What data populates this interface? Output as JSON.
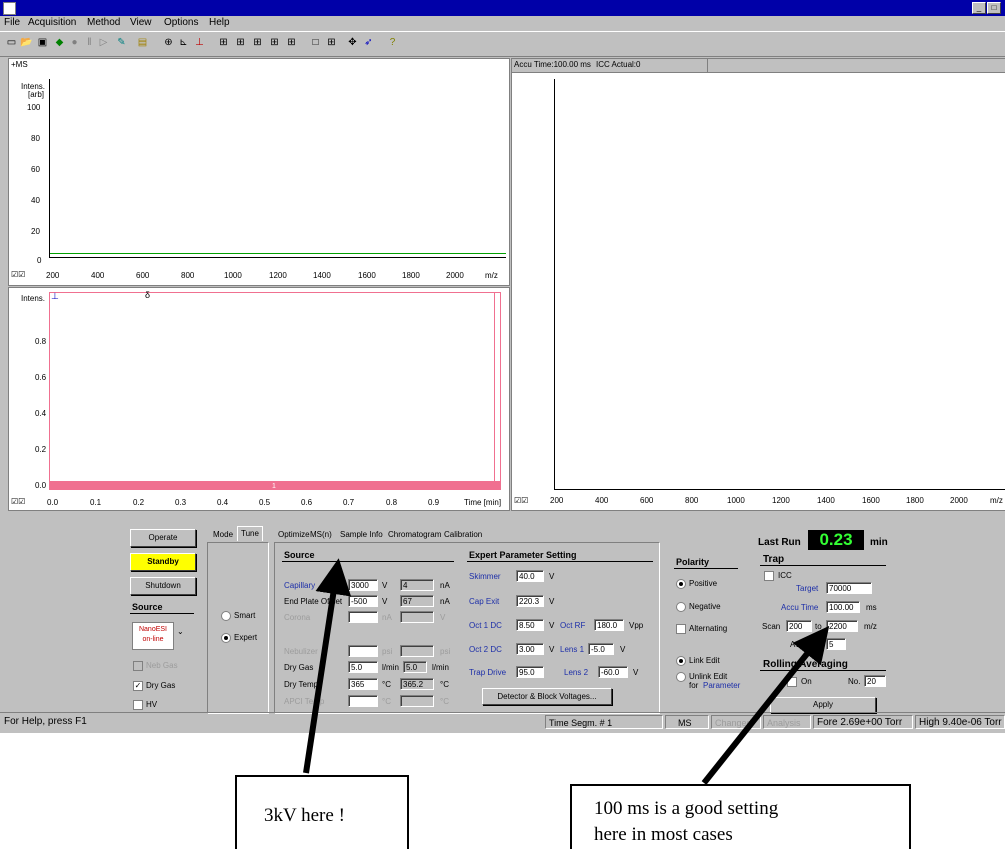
{
  "window": {
    "minimize_glyph": "_",
    "maximize_glyph": "□"
  },
  "menu": [
    "File",
    "Acquisition",
    "Method",
    "View",
    "Options",
    "Help"
  ],
  "toolbar_icons": [
    "new-icon",
    "open-icon",
    "save-icon",
    "start-icon",
    "stop-icon",
    "pause-icon",
    "step-icon",
    "tune-icon",
    "folder-icon",
    "zoom-icon",
    "calibrate-icon",
    "peak-icon",
    "layout1-icon",
    "layout2-icon",
    "layout3-icon",
    "layout4-icon",
    "layout5-icon",
    "window-icon",
    "grid-icon",
    "arrow-icon",
    "cursor-icon",
    "help-icon"
  ],
  "spectrum": {
    "polarity_label": "+MS",
    "y_label_1": "Intens.",
    "y_label_2": "[arb]",
    "y_ticks": [
      "100",
      "80",
      "60",
      "40",
      "20",
      "0"
    ],
    "x_ticks": [
      "200",
      "400",
      "600",
      "800",
      "1000",
      "1200",
      "1400",
      "1600",
      "1800",
      "2000"
    ],
    "x_unit": "m/z",
    "checkboxes": "☑☑"
  },
  "chromatogram": {
    "y_label": "Intens.",
    "y_ticks": [
      "0.8",
      "0.6",
      "0.4",
      "0.2",
      "0.0"
    ],
    "x_ticks": [
      "0.0",
      "0.1",
      "0.2",
      "0.3",
      "0.4",
      "0.5",
      "0.6",
      "0.7",
      "0.8",
      "0.9"
    ],
    "x_unit": "Time [min]",
    "marker": "δ",
    "segment_label": "1",
    "checkboxes": "☑☑"
  },
  "right_pane": {
    "header_accu": "Accu Time:100.00 ms",
    "header_icc": "ICC Actual:0",
    "x_ticks": [
      "200",
      "400",
      "600",
      "800",
      "1000",
      "1200",
      "1400",
      "1600",
      "1800",
      "2000"
    ],
    "x_unit": "m/z",
    "checkboxes": "☑☑"
  },
  "control": {
    "operate": "Operate",
    "standby": "Standby",
    "shutdown": "Shutdown",
    "source_title": "Source",
    "source_box": "NanoESI\non-line",
    "neb_gas": "Neb Gas",
    "dry_gas": "Dry Gas",
    "hv": "HV",
    "tabs": [
      "Mode",
      "Tune",
      "Optimize",
      "MS(n)",
      "Sample Info",
      "Chromatogram",
      "Calibration"
    ],
    "mode_smart": "Smart",
    "mode_expert": "Expert",
    "source_section": "Source",
    "rows": [
      {
        "label": "Capillary",
        "value": "3000",
        "unit": "V",
        "actual": "4",
        "unit2": "nA"
      },
      {
        "label": "End Plate Offset",
        "value": "-500",
        "unit": "V",
        "actual": "67",
        "unit2": "nA"
      },
      {
        "label": "Corona",
        "value": "",
        "unit": "nA",
        "actual": "",
        "unit2": "V"
      },
      {
        "label": "Nebulizer",
        "value": "",
        "unit": "psi",
        "actual": "",
        "unit2": "psi"
      },
      {
        "label": "Dry Gas",
        "value": "5.0",
        "unit": "l/min",
        "actual": "5.0",
        "unit2": "l/min"
      },
      {
        "label": "Dry Temp",
        "value": "365",
        "unit": "°C",
        "actual": "365.2",
        "unit2": "°C"
      },
      {
        "label": "APCI Temp",
        "value": "",
        "unit": "°C",
        "actual": "",
        "unit2": "°C"
      }
    ],
    "expert_title": "Expert Parameter Setting",
    "skimmer_label": "Skimmer",
    "skimmer": "40.0",
    "skimmer_unit": "V",
    "capexit_label": "Cap Exit",
    "capexit": "220.3",
    "capexit_unit": "V",
    "oct1_label": "Oct 1 DC",
    "oct1": "8.50",
    "oct1_unit": "V",
    "octrf_label": "Oct RF",
    "octrf": "180.0",
    "octrf_unit": "Vpp",
    "oct2_label": "Oct 2 DC",
    "oct2": "3.00",
    "oct2_unit": "V",
    "lens1_label": "Lens 1",
    "lens1": "-5.0",
    "lens1_unit": "V",
    "trap_label": "Trap Drive",
    "trap": "95.0",
    "lens2_label": "Lens 2",
    "lens2": "-60.0",
    "lens2_unit": "V",
    "detector_btn": "Detector & Block Voltages...",
    "polarity_title": "Polarity",
    "positive": "Positive",
    "negative": "Negative",
    "alternating": "Alternating",
    "link_edit": "Link Edit",
    "unlink_edit": "Unlink Edit",
    "for_param_1": "for",
    "for_param_2": "Parameter",
    "last_run_label": "Last Run",
    "last_run_value": "0.23",
    "last_run_unit": "min",
    "trap_title": "Trap",
    "icc": "ICC",
    "target_label": "Target",
    "target": "70000",
    "accu_label": "Accu Time",
    "accu": "100.00",
    "accu_unit": "ms",
    "scan_label": "Scan",
    "scan_from": "200",
    "scan_to_label": "to",
    "scan_to": "2200",
    "scan_unit": "m/z",
    "averages_label": "Averages",
    "averages": "5",
    "rolling_title": "Rolling Averaging",
    "on_label": "On",
    "no_label": "No.",
    "no_value": "20",
    "apply": "Apply"
  },
  "statusbar": {
    "help": "For Help, press F1",
    "time_segm": "Time Segm. # 1",
    "ms": "MS",
    "changed": "Changed",
    "analysis": "Analysis",
    "fore": "Fore 2.69e+00 Torr",
    "high": "High 9.40e-06 Torr"
  },
  "callouts": {
    "left": "3kV here !",
    "right_1": "100 ms is a good setting",
    "right_2": "here in most cases"
  },
  "colors": {
    "accent_blue": "#1c2ea8",
    "standby_yellow": "#ffff00",
    "lcd_green": "#33ff33",
    "chrom_red": "#f07090",
    "title_blue": "#0000a8"
  }
}
